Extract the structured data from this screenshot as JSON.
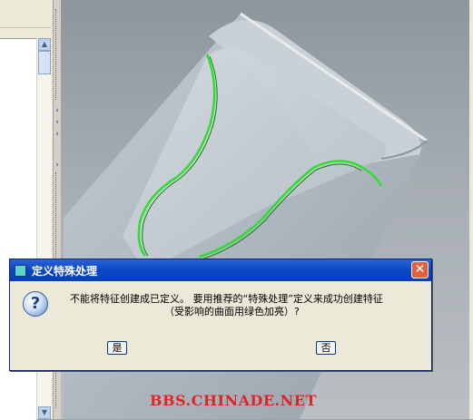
{
  "dialog": {
    "title": "定义特殊处理",
    "close_glyph": "✕",
    "icon": "question-icon",
    "message_line1": "不能将特征创建成已定义。 要用推荐的“特殊处理”定义来成功创建特征",
    "message_line2": "（受影响的曲面用绿色加亮）?",
    "yes_label": "是",
    "no_label": "否"
  },
  "left_panel": {
    "collapse_marks": [
      "‹",
      "‹",
      "‹",
      "›"
    ]
  },
  "watermark": "BBS.CHINADE.NET",
  "colors": {
    "highlight_curve": "#2ee02e",
    "title_bar": "#0a47c4",
    "watermark": "#e02525"
  }
}
